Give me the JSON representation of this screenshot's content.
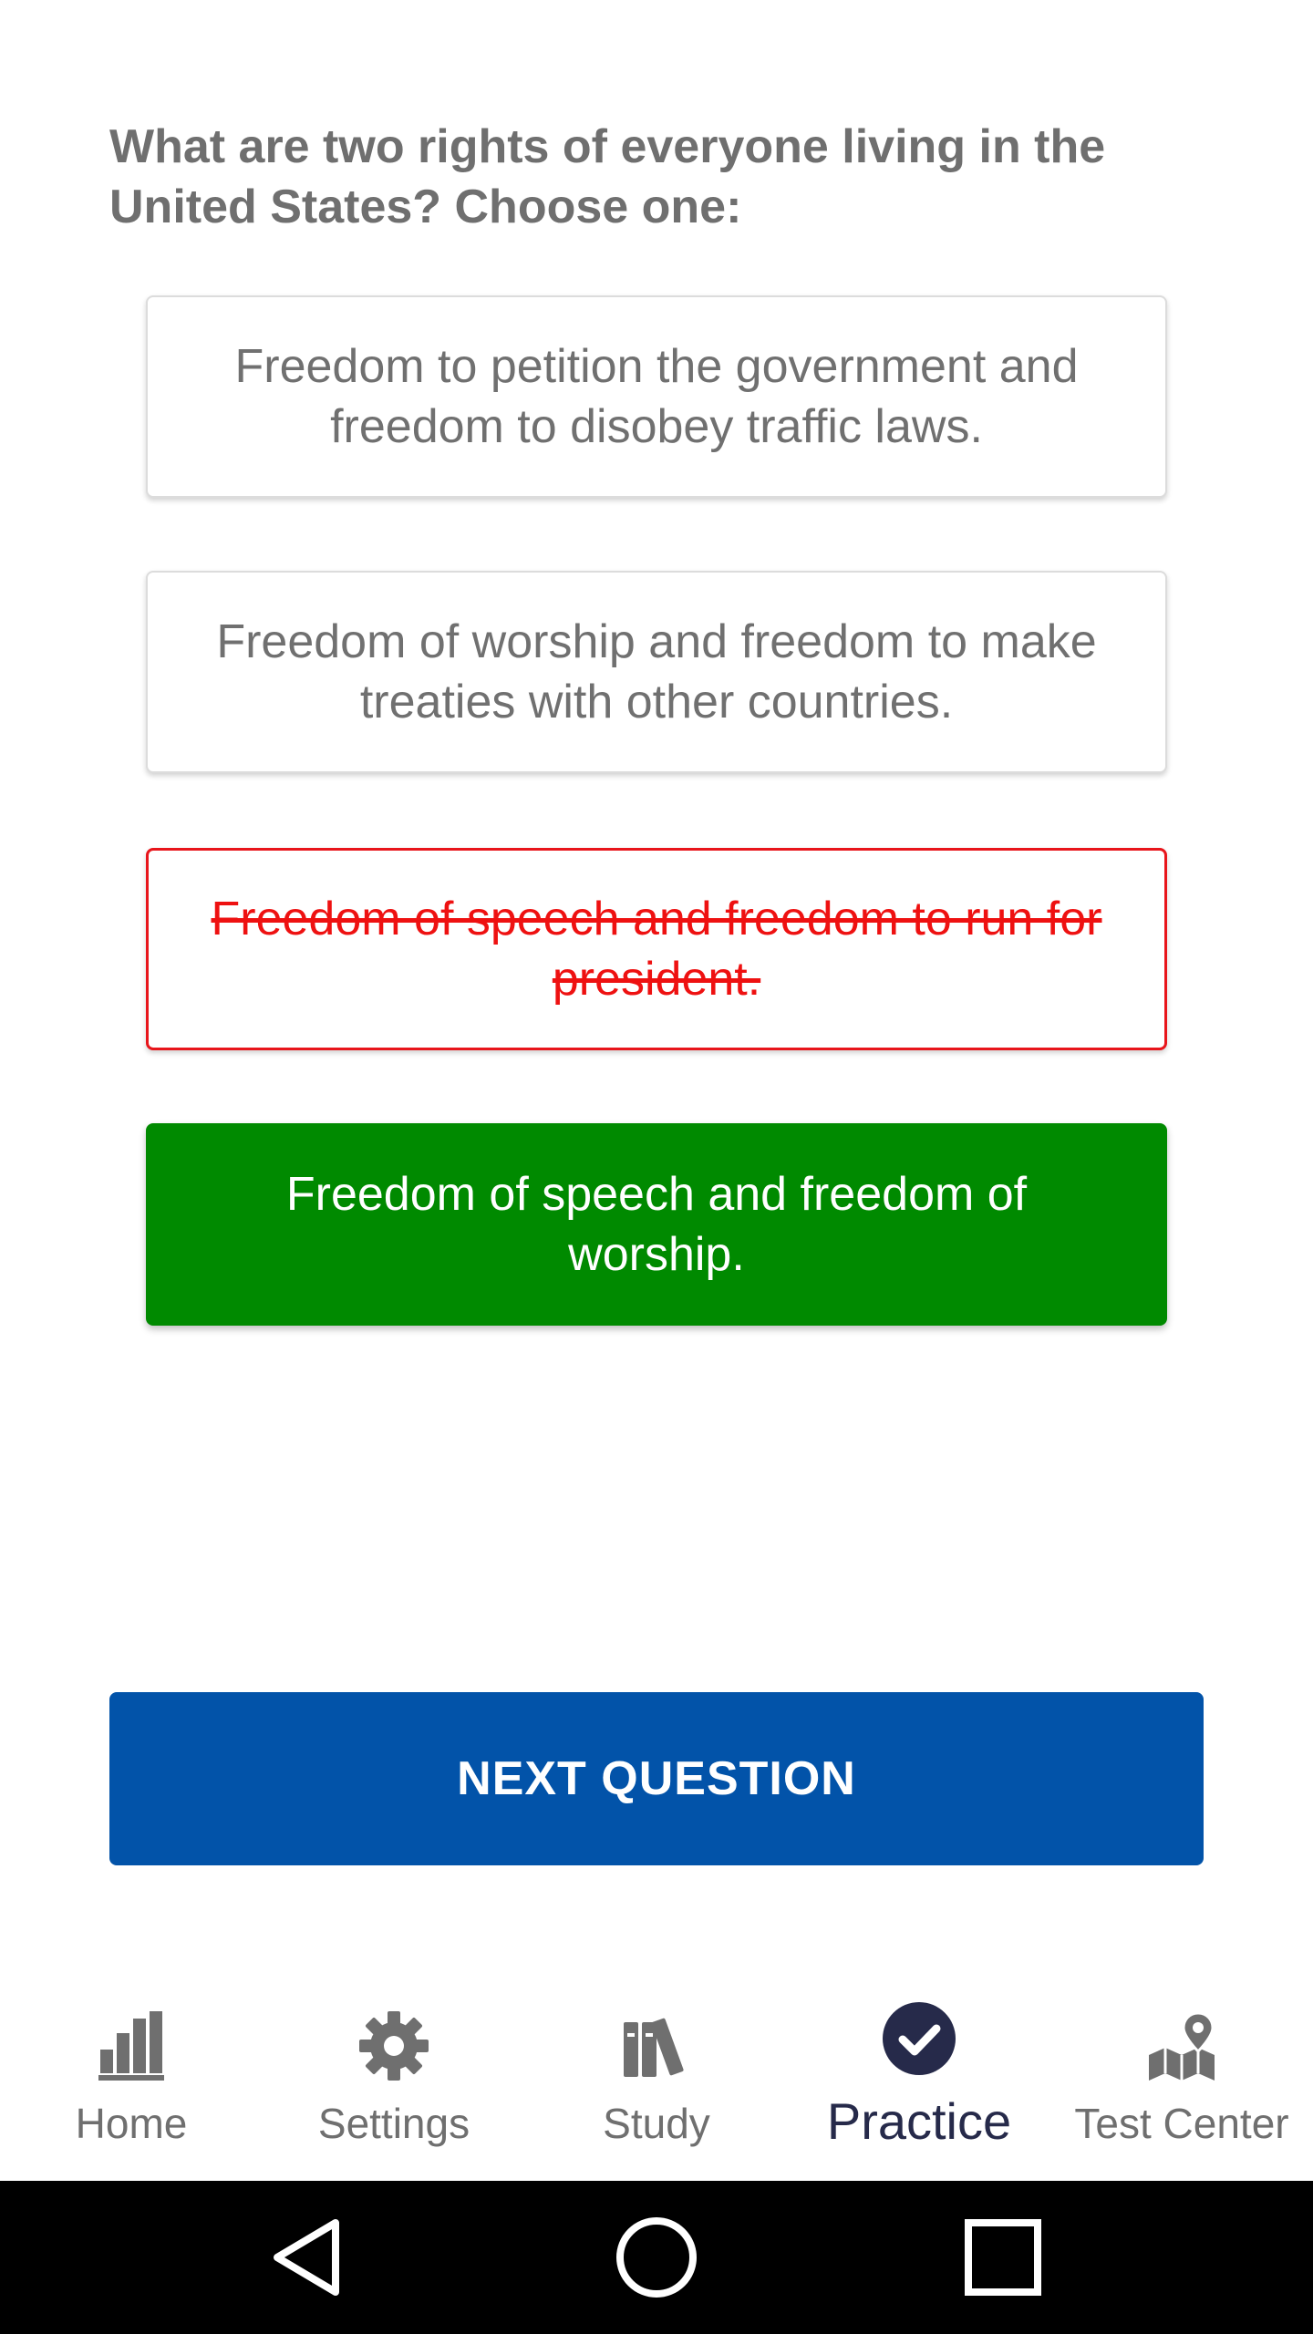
{
  "question": {
    "text": "What are two rights of everyone living in the United States? Choose one:"
  },
  "answers": [
    {
      "label": "Freedom to petition the government and freedom to disobey traffic laws.",
      "state": "neutral"
    },
    {
      "label": "Freedom of worship and freedom to make treaties with other countries.",
      "state": "neutral"
    },
    {
      "label": "Freedom of speech and freedom to run for president.",
      "state": "wrong"
    },
    {
      "label": "Freedom of speech and freedom of worship.",
      "state": "correct"
    }
  ],
  "next_button": {
    "label": "NEXT QUESTION"
  },
  "bottom_nav": {
    "items": [
      {
        "label": "Home",
        "icon": "bar-chart-icon",
        "active": false
      },
      {
        "label": "Settings",
        "icon": "gear-icon",
        "active": false
      },
      {
        "label": "Study",
        "icon": "books-icon",
        "active": false
      },
      {
        "label": "Practice",
        "icon": "check-circle-icon",
        "active": true
      },
      {
        "label": "Test Center",
        "icon": "map-pin-icon",
        "active": false
      }
    ]
  },
  "colors": {
    "question_text": "#6f6f6f",
    "wrong": "#ee1111",
    "correct": "#008a00",
    "primary_button": "#0253a9",
    "nav_inactive": "#6f6f6f",
    "nav_active": "#262a4a"
  }
}
